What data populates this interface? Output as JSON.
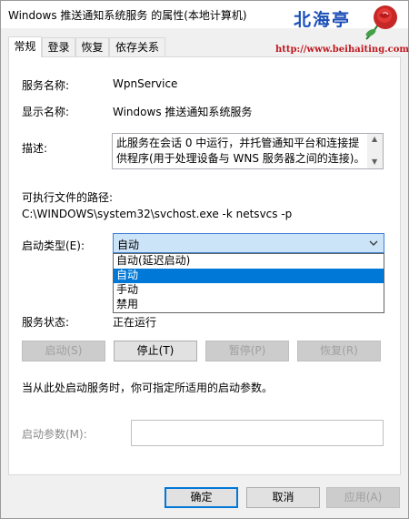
{
  "window": {
    "title": "Windows 推送通知系统服务 的属性(本地计算机)"
  },
  "watermark": {
    "name": "北海亭",
    "url": "http://www.beihaiting.com"
  },
  "tabs": [
    "常规",
    "登录",
    "恢复",
    "依存关系"
  ],
  "general": {
    "service_name_label": "服务名称:",
    "service_name": "WpnService",
    "display_name_label": "显示名称:",
    "display_name": "Windows 推送通知系统服务",
    "description_label": "描述:",
    "description": "此服务在会话 0 中运行，并托管通知平台和连接提供程序(用于处理设备与 WNS 服务器之间的连接)。",
    "exe_path_label": "可执行文件的路径:",
    "exe_path": "C:\\WINDOWS\\system32\\svchost.exe -k netsvcs -p",
    "startup_type_label": "启动类型(E):",
    "startup_type_value": "自动",
    "startup_options": [
      "自动(延迟启动)",
      "自动",
      "手动",
      "禁用"
    ],
    "startup_selected_index": 1,
    "service_status_label": "服务状态:",
    "service_status": "正在运行",
    "buttons": {
      "start": "启动(S)",
      "stop": "停止(T)",
      "pause": "暂停(P)",
      "resume": "恢复(R)"
    },
    "hint": "当从此处启动服务时，你可指定所适用的启动参数。",
    "start_params_label": "启动参数(M):",
    "start_params_value": ""
  },
  "footer": {
    "ok": "确定",
    "cancel": "取消",
    "apply": "应用(A)"
  },
  "colors": {
    "selection": "#0078d7",
    "select_bg": "#cce4f7",
    "watermark_blue": "#1c4fb7",
    "watermark_red": "#c0181f"
  }
}
